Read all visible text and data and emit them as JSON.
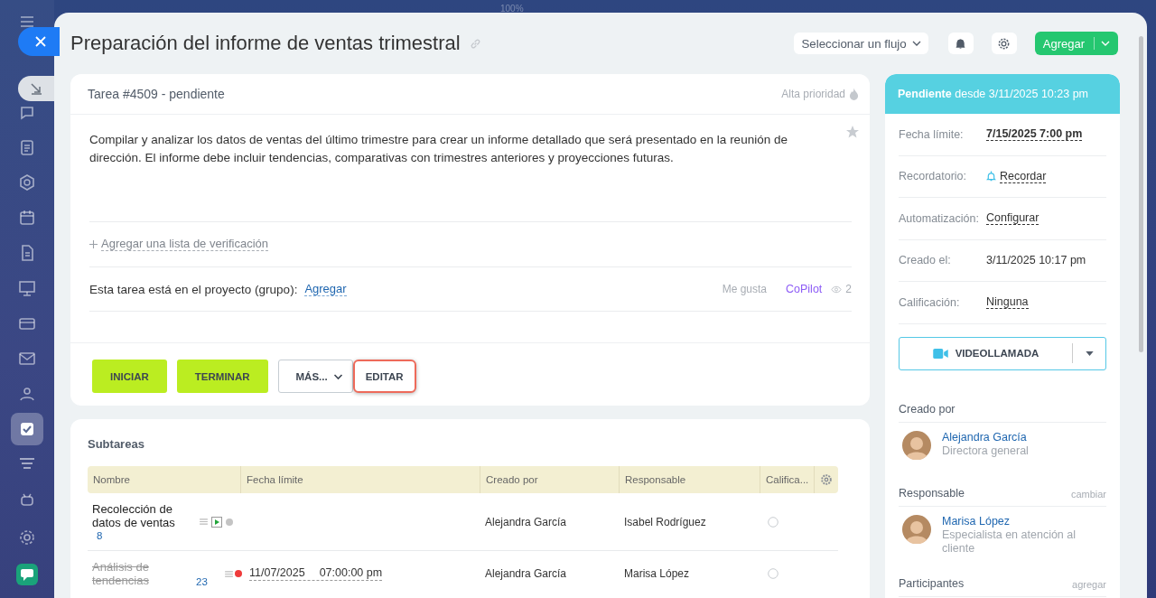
{
  "sidebar": {
    "items": [
      {
        "selected": false
      },
      {
        "selected": false
      },
      {
        "selected": false
      },
      {
        "selected": false
      },
      {
        "selected": false
      },
      {
        "selected": false
      },
      {
        "selected": false
      },
      {
        "selected": false
      },
      {
        "selected": false
      },
      {
        "selected": true
      },
      {
        "selected": false
      },
      {
        "selected": false
      }
    ]
  },
  "zoom_label": "100%",
  "header": {
    "title": "Preparación del informe de ventas trimestral",
    "flow_select": "Seleccionar un flujo",
    "add_button": "Agregar"
  },
  "task": {
    "number": "Tarea #4509 - pendiente",
    "priority": "Alta prioridad",
    "description": "Compilar y analizar los datos de ventas del último trimestre para crear un informe detallado que será presentado en la reunión de dirección. El informe debe incluir tendencias, comparativas con trimestres anteriores y proyecciones futuras.",
    "checklist_link": "Agregar una lista de verificación",
    "project_label": "Esta tarea está en el proyecto (grupo):",
    "project_link": "Agregar",
    "like": "Me gusta",
    "copilot": "CoPilot",
    "views": "2",
    "buttons": [
      {
        "label": "INICIAR",
        "kind": "primary",
        "highlighted": false
      },
      {
        "label": "TERMINAR",
        "kind": "primary",
        "highlighted": false
      },
      {
        "label": "MÁS...",
        "kind": "menu",
        "highlighted": false
      },
      {
        "label": "EDITAR",
        "kind": "plain",
        "highlighted": true
      }
    ]
  },
  "status": {
    "text": "**Pendiente** desde 3/11/2025 10:23 pm"
  },
  "fields": [
    {
      "label": "Fecha límite:",
      "value": "7/15/2025 7:00 pm",
      "kind": "deadline"
    },
    {
      "label": "Recordatorio:",
      "value": "Recordar",
      "kind": "reminder"
    },
    {
      "label": "Automatización:",
      "value": "Configurar",
      "kind": "link"
    },
    {
      "label": "Creado el:",
      "value": "3/11/2025 10:17 pm",
      "kind": "text"
    },
    {
      "label": "Calificación:",
      "value": "Ninguna",
      "kind": "link"
    }
  ],
  "video_call": "VIDEOLLAMADA",
  "people": [
    {
      "heading": "Creado por",
      "name": "Alejandra García",
      "role": "Directora general"
    },
    {
      "heading": "Responsable",
      "action": "cambiar",
      "name": "Marisa López",
      "role": "Especialista en atención al cliente"
    }
  ],
  "participants": {
    "heading": "Participantes",
    "action": "agregar"
  },
  "subtasks": {
    "title": "Subtareas",
    "columns": [
      "Nombre",
      "Fecha límite",
      "Creado por",
      "Responsable",
      "Califica..."
    ],
    "rows": [
      {
        "name": "Recolección de datos de ventas",
        "count": "8",
        "completed": false,
        "timer": true,
        "color": "#c4c4c4",
        "created_by": "Alejandra García",
        "responsible": "Isabel Rodríguez"
      },
      {
        "name": "Análisis de tendencias",
        "count": "23",
        "completed": true,
        "timer": false,
        "color": "#ef3b3b",
        "date": "11/07/2025",
        "time": "07:00:00 pm",
        "created_by": "Alejandra García",
        "responsible": "Marisa López"
      }
    ]
  }
}
